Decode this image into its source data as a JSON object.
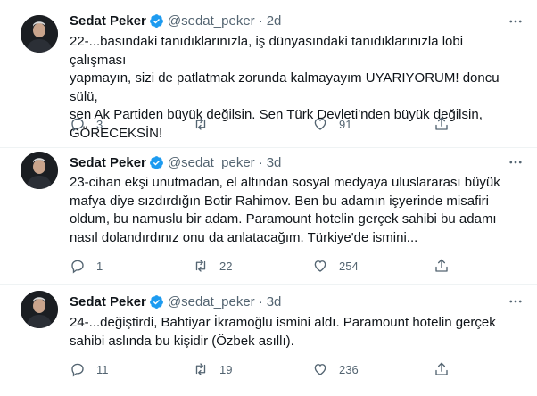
{
  "tweets": [
    {
      "name": "Sedat Peker",
      "handle": "@sedat_peker",
      "separator": "·",
      "time": "2d",
      "text": "22-...basındaki tanıdıklarınızla, iş dünyasındaki tanıdıklarınızla lobi çalışması\nyapmayın, sizi de patlatmak zorunda kalmayayım UYARIYORUM! doncu sülü,\nsen Ak Partiden büyük değilsin. Sen Türk Devleti'nden büyük değilsin,\nGÖRECEKSİN!",
      "replies": "3",
      "retweets": "",
      "likes": "91"
    },
    {
      "name": "Sedat Peker",
      "handle": "@sedat_peker",
      "separator": "·",
      "time": "3d",
      "text": "23-cihan ekşi unutmadan, el altından sosyal medyaya uluslararası büyük\nmafya diye sızdırdığın Botir Rahimov. Ben bu adamın işyerinde misafiri\noldum, bu namuslu bir adam. Paramount hotelin gerçek sahibi bu adamı\nnasıl dolandırdınız onu da anlatacağım. Türkiye'de ismini...",
      "replies": "1",
      "retweets": "22",
      "likes": "254"
    },
    {
      "name": "Sedat Peker",
      "handle": "@sedat_peker",
      "separator": "·",
      "time": "3d",
      "text": "24-...değiştirdi, Bahtiyar İkramoğlu ismini aldı. Paramount hotelin gerçek\nsahibi aslında bu kişidir (Özbek asıllı).",
      "replies": "11",
      "retweets": "19",
      "likes": "236"
    }
  ],
  "icons": {
    "avatar": "avatar",
    "verified": "verified-badge-icon",
    "more": "more-options-icon",
    "reply": "reply-icon",
    "retweet": "retweet-icon",
    "like": "heart-icon",
    "share": "share-icon"
  },
  "colors": {
    "verified": "#1d9bf0",
    "secondary_text": "#536471",
    "divider": "#eff3f4"
  }
}
